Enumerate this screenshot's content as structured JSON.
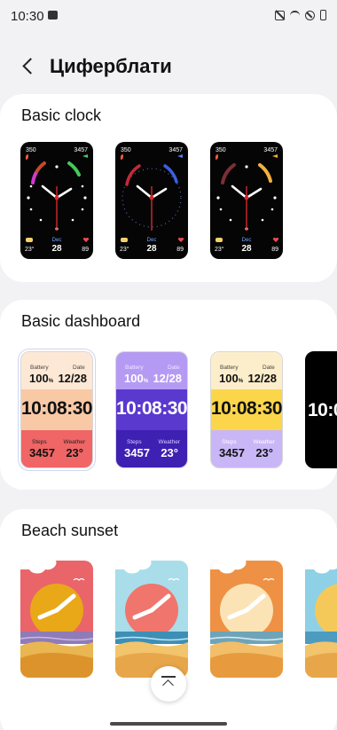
{
  "status_bar": {
    "time": "10:30",
    "icons": [
      "gallery-icon",
      "mute-icon",
      "wifi-icon",
      "do-not-disturb-icon",
      "battery-icon"
    ]
  },
  "header": {
    "title": "Циферблати"
  },
  "sections": {
    "basic_clock": {
      "title": "Basic clock",
      "faces": [
        {
          "tl": "350",
          "tr": "3457",
          "month": "Dec",
          "temp": "23°",
          "day": "28",
          "heart": "89"
        },
        {
          "tl": "350",
          "tr": "3457",
          "month": "Dec",
          "temp": "23°",
          "day": "28",
          "heart": "89"
        },
        {
          "tl": "350",
          "tr": "3457",
          "month": "Dec",
          "temp": "23°",
          "day": "28",
          "heart": "89"
        }
      ]
    },
    "basic_dashboard": {
      "title": "Basic dashboard",
      "faces": [
        {
          "battery_label": "Battery",
          "battery": "100",
          "battery_unit": "%",
          "date_label": "Date",
          "date": "12/28",
          "time": "10:08:30",
          "steps_label": "Steps",
          "steps": "3457",
          "weather_label": "Weather",
          "weather": "23°"
        },
        {
          "battery_label": "Battery",
          "battery": "100",
          "battery_unit": "%",
          "date_label": "Date",
          "date": "12/28",
          "time": "10:08:30",
          "steps_label": "Steps",
          "steps": "3457",
          "weather_label": "Weather",
          "weather": "23°"
        },
        {
          "battery_label": "Battery",
          "battery": "100",
          "battery_unit": "%",
          "date_label": "Date",
          "date": "12/28",
          "time": "10:08:30",
          "steps_label": "Steps",
          "steps": "3457",
          "weather_label": "Weather",
          "weather": "23°"
        },
        {
          "time": "10:0"
        }
      ]
    },
    "beach_sunset": {
      "title": "Beach sunset"
    }
  },
  "colors": {
    "accent": "#d4282c",
    "dash1_text": "#111111",
    "dash2_text": "#ffffff",
    "dash3_text": "#111111"
  }
}
